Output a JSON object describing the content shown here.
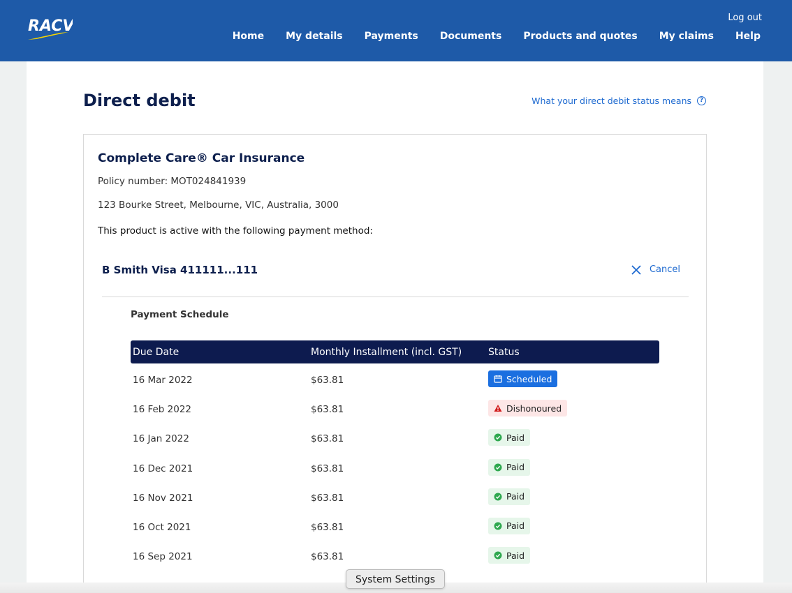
{
  "brand": {
    "logo_text": "RACV",
    "header_color": "#1e5aa8",
    "logo_stripe_color": "#f5d400"
  },
  "header": {
    "logout": "Log out",
    "nav": [
      "Home",
      "My details",
      "Payments",
      "Documents",
      "Products and quotes",
      "My claims",
      "Help"
    ]
  },
  "page": {
    "title": "Direct debit",
    "help_link": "What your direct debit status means",
    "help_icon": "question-circle-icon"
  },
  "product": {
    "title": "Complete Care® Car Insurance",
    "policy": "Policy number: MOT024841939",
    "address": "123 Bourke Street, Melbourne, VIC, Australia, 3000",
    "active_text": "This product is active with the following payment method:",
    "payment_method": "B Smith Visa 411111...111",
    "cancel_label": "Cancel"
  },
  "schedule": {
    "title": "Payment Schedule",
    "columns": [
      "Due Date",
      "Monthly Installment (incl. GST)",
      "Status"
    ],
    "rows": [
      {
        "date": "16 Mar 2022",
        "amount": "$63.81",
        "status": "Scheduled",
        "status_type": "scheduled"
      },
      {
        "date": "16 Feb 2022",
        "amount": "$63.81",
        "status": "Dishonoured",
        "status_type": "dishonoured"
      },
      {
        "date": "16 Jan 2022",
        "amount": "$63.81",
        "status": "Paid",
        "status_type": "paid"
      },
      {
        "date": "16 Dec 2021",
        "amount": "$63.81",
        "status": "Paid",
        "status_type": "paid"
      },
      {
        "date": "16 Nov 2021",
        "amount": "$63.81",
        "status": "Paid",
        "status_type": "paid"
      },
      {
        "date": "16 Oct 2021",
        "amount": "$63.81",
        "status": "Paid",
        "status_type": "paid"
      },
      {
        "date": "16 Sep 2021",
        "amount": "$63.81",
        "status": "Paid",
        "status_type": "paid"
      }
    ]
  },
  "colors": {
    "scheduled": "#1b6fe0",
    "dishonoured": "#d11a1a",
    "paid": "#2fa84f",
    "table_header": "#0d1b4f"
  },
  "tooltip": "System Settings"
}
